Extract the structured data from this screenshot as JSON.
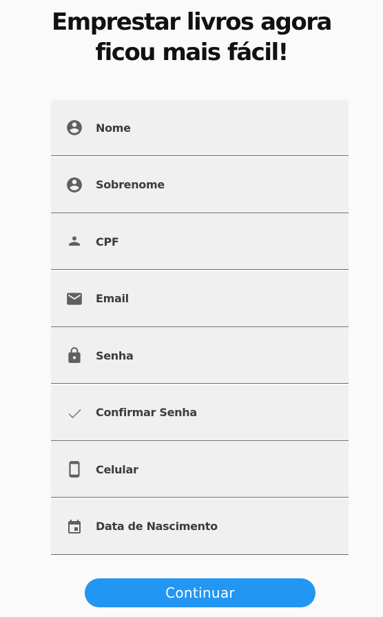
{
  "header": {
    "title_line_1": "Emprestar livros agora",
    "title_line_2": "ficou mais fácil!"
  },
  "form": {
    "fields": [
      {
        "label": "Nome",
        "icon": "account-circle-icon",
        "value": ""
      },
      {
        "label": "Sobrenome",
        "icon": "account-circle-icon",
        "value": ""
      },
      {
        "label": "CPF",
        "icon": "person-icon",
        "value": ""
      },
      {
        "label": "Email",
        "icon": "mail-icon",
        "value": ""
      },
      {
        "label": "Senha",
        "icon": "lock-icon",
        "value": ""
      },
      {
        "label": "Confirmar Senha",
        "icon": "check-icon",
        "value": ""
      },
      {
        "label": "Celular",
        "icon": "smartphone-icon",
        "value": ""
      },
      {
        "label": "Data de Nascimento",
        "icon": "calendar-icon",
        "value": ""
      }
    ]
  },
  "actions": {
    "continue_label": "Continuar"
  },
  "colors": {
    "primary": "#2196f3",
    "field_background": "#f0f0f0",
    "field_underline": "#6e6e6e",
    "icon": "#606060",
    "page_background": "#fafafa"
  }
}
